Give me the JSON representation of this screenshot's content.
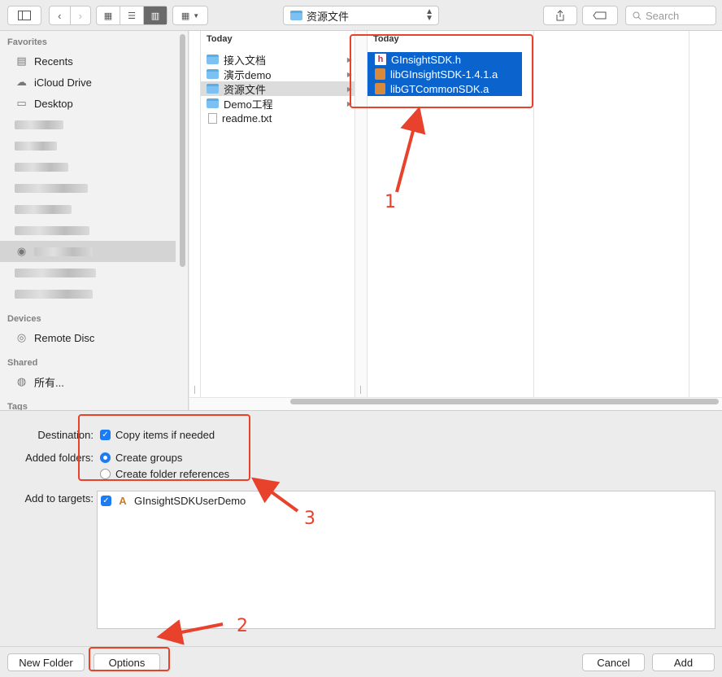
{
  "toolbar": {
    "location": "资源文件",
    "search_placeholder": "Search"
  },
  "sidebar": {
    "favorites_header": "Favorites",
    "favorites": [
      {
        "label": "Recents",
        "icon": "recents-icon"
      },
      {
        "label": "iCloud Drive",
        "icon": "cloud-icon"
      },
      {
        "label": "Desktop",
        "icon": "desktop-icon"
      }
    ],
    "devices_header": "Devices",
    "remote_disc": "Remote Disc",
    "shared_header": "Shared",
    "shared_all": "所有...",
    "tags_header": "Tags"
  },
  "browser": {
    "col1_header": "Today",
    "col1_items": [
      "接入文档",
      "演示demo",
      "资源文件",
      "Demo工程",
      "readme.txt"
    ],
    "col2_header": "Today",
    "col2_items": [
      "GInsightSDK.h",
      "libGInsightSDK-1.4.1.a",
      "libGTCommonSDK.a"
    ]
  },
  "options": {
    "destination_label": "Destination:",
    "copy_items": "Copy items if needed",
    "added_folders_label": "Added folders:",
    "create_groups": "Create groups",
    "create_folder_refs": "Create folder references",
    "add_to_targets_label": "Add to targets:",
    "target_name": "GInsightSDKUserDemo"
  },
  "bottom": {
    "new_folder": "New Folder",
    "options": "Options",
    "cancel": "Cancel",
    "add": "Add"
  },
  "annotations": {
    "n1": "1",
    "n2": "2",
    "n3": "3",
    "color": "#e8412c"
  }
}
